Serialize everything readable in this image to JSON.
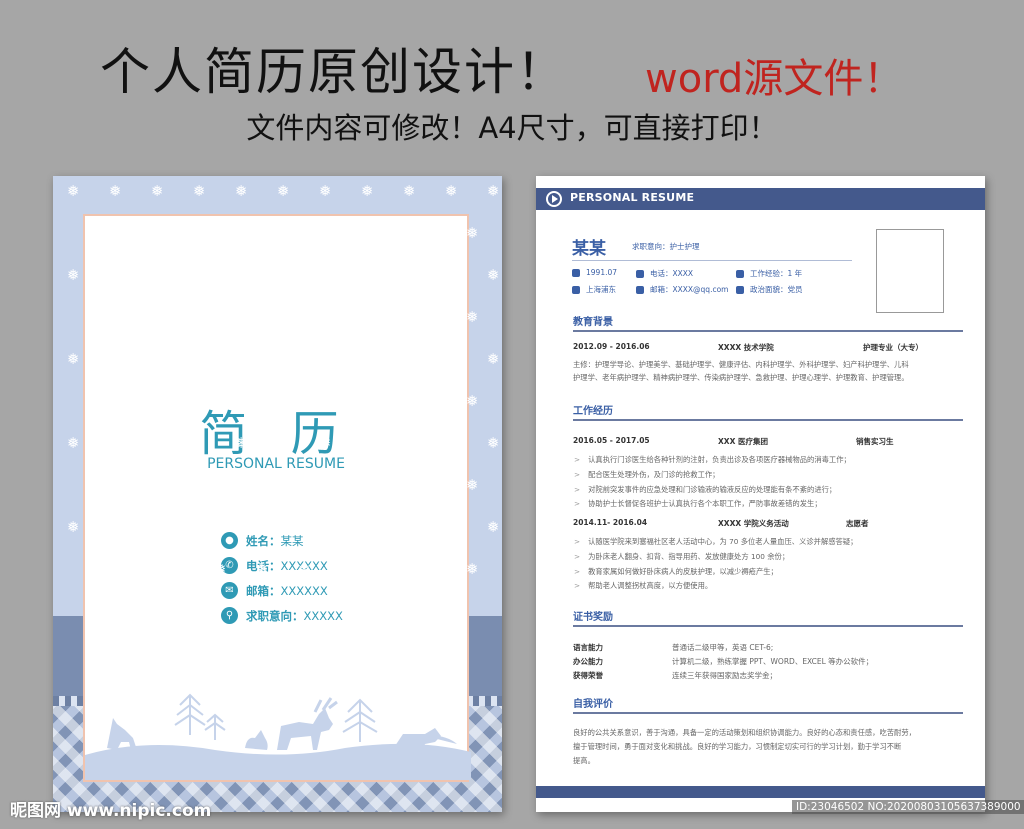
{
  "headline": {
    "main": "个人简历原创设计！",
    "accent": "word源文件！",
    "sub": "文件内容可修改！A4尺寸，可直接打印！"
  },
  "cover": {
    "title_cn": "简 历",
    "title_en": "PERSONAL RESUME",
    "fields": [
      {
        "icon": "person-icon",
        "label": "姓名：",
        "value": "某某"
      },
      {
        "icon": "phone-icon",
        "label": "电话：",
        "value": "XXXXXX"
      },
      {
        "icon": "mail-icon",
        "label": "邮箱：",
        "value": "XXXXXX"
      },
      {
        "icon": "search-icon",
        "label": "求职意向：",
        "value": "XXXXX"
      }
    ]
  },
  "resume": {
    "header": "PERSONAL RESUME",
    "name": "某某",
    "intent": "求职意向：护士护理",
    "meta": {
      "birth": "1991.07",
      "phone": "电话：XXXX",
      "experience": "工作经验：1 年",
      "location": "上海浦东",
      "email": "邮箱：XXXX@qq.com",
      "politics": "政治面貌：党员"
    },
    "education": {
      "title": "教育背景",
      "period": "2012.09 - 2016.06",
      "school": "XXXX 技术学院",
      "major": "护理专业（大专）",
      "courses_1": "主修：护理学导论、护理美学、基础护理学、健康评估、内科护理学、外科护理学、妇产科护理学、儿科",
      "courses_2": "护理学、老年病护理学、精神病护理学、传染病护理学、急救护理、护理心理学、护理教育、护理管理。"
    },
    "work": {
      "title": "工作经历",
      "jobs": [
        {
          "period": "2016.05 - 2017.05",
          "org": "XXX 医疗集团",
          "role": "销售实习生",
          "items": [
            "认真执行门诊医生给各种针剂的注射，负责出诊及各项医疗器械物品的消毒工作；",
            "配合医生处理外伤，及门诊的抢救工作；",
            "对院前突发事件的应急处理和门诊输液的输液反应的处理能有条不紊的进行；",
            "协助护士长督促各班护士认真执行各个本职工作，严防事故差错的发生；"
          ]
        },
        {
          "period": "2014.11- 2016.04",
          "org": "XXXX 学院义务活动",
          "role": "志愿者",
          "items": [
            "认随医学院来到塞福社区老人活动中心，为 70 多位老人量血压、义诊并解感答疑；",
            "为卧床老人翻身、扣背、指导用药、发放健康处方 100 余份；",
            "教育家属如何做好卧床病人的皮肤护理，以减少褥疮产生；",
            "帮助老人调整拐杖高度，以方便使用。"
          ]
        }
      ]
    },
    "certs": {
      "title": "证书奖励",
      "rows": [
        {
          "label": "语言能力",
          "value": "普通话二级甲等，英语 CET-6;"
        },
        {
          "label": "办公能力",
          "value": "计算机二级，熟练掌握 PPT、WORD、EXCEL 等办公软件；"
        },
        {
          "label": "获得荣誉",
          "value": "连续三年获得国家励志奖学金；"
        }
      ]
    },
    "self": {
      "title": "自我评价",
      "lines": [
        "良好的公共关系意识，善于沟通，具备一定的活动策划和组织协调能力。良好的心态和责任感，吃苦耐劳，",
        "擅于管理时间，勇于面对变化和挑战。良好的学习能力，习惯制定切实可行的学习计划，勤于学习不断",
        "提高。"
      ]
    }
  },
  "watermark": {
    "left": "昵图网 www.nipic.com",
    "right": "ID:23046502 NO:20200803105637389000"
  }
}
